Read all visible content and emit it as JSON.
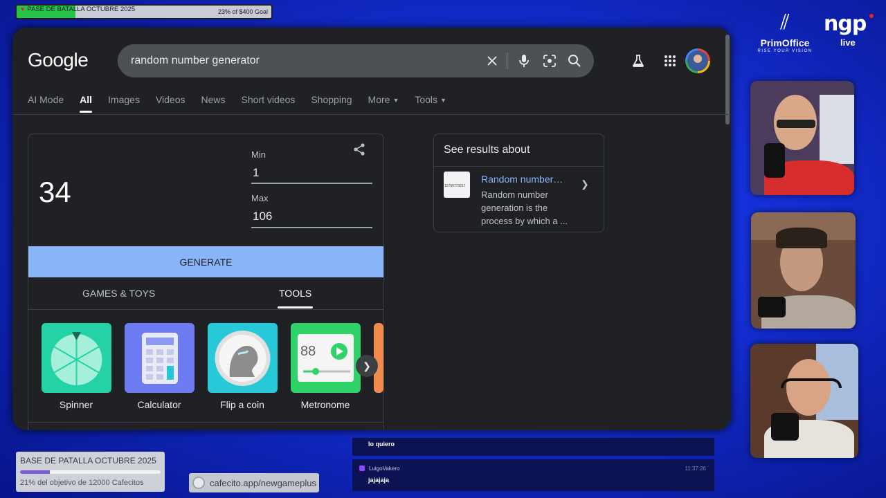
{
  "overlay": {
    "top_goal": {
      "title": "PASE DE BATALLA OCTUBRE 2025",
      "amount": "23% of $400 Goal",
      "progress_pct": 23
    },
    "bottom_goal": {
      "title": "BASE DE PATALLA OCTUBRE 2025",
      "subtitle": "21% del objetivo de 12000 Cafecitos",
      "progress_pct": 21
    },
    "cafecito_link": "cafecito.app/newgameplus",
    "brand_left": {
      "mark": "⫽",
      "name": "PrimOffice",
      "tagline": "RISE YOUR VISION"
    },
    "brand_right": {
      "big": "ngp",
      "small": "live"
    },
    "chat": [
      {
        "user": "",
        "text": "lo quiero",
        "time": ""
      },
      {
        "user": "LuigoVakero",
        "text": "jajajaja",
        "time": "11:37:26"
      }
    ]
  },
  "google": {
    "logo": "Google",
    "search_query": "random number generator",
    "icons": {
      "clear": "close-icon",
      "voice": "mic-icon",
      "lens": "lens-icon",
      "search": "search-icon",
      "labs": "flask-icon",
      "apps": "apps-grid-icon"
    },
    "tabs": [
      {
        "label": "AI Mode",
        "active": false
      },
      {
        "label": "All",
        "active": true
      },
      {
        "label": "Images",
        "active": false
      },
      {
        "label": "Videos",
        "active": false
      },
      {
        "label": "News",
        "active": false
      },
      {
        "label": "Short videos",
        "active": false
      },
      {
        "label": "Shopping",
        "active": false
      },
      {
        "label": "More",
        "active": false,
        "dropdown": true
      },
      {
        "label": "Tools",
        "active": false,
        "dropdown": true
      }
    ],
    "rng": {
      "result": "34",
      "min_label": "Min",
      "min_value": "1",
      "max_label": "Max",
      "max_value": "106",
      "generate_label": "GENERATE",
      "subtabs": [
        "GAMES & TOYS",
        "TOOLS"
      ],
      "active_subtab": "TOOLS",
      "tools": [
        {
          "label": "Spinner",
          "color": "#23d3a5"
        },
        {
          "label": "Calculator",
          "color": "#6d7cf2"
        },
        {
          "label": "Flip a coin",
          "color": "#27c9d8"
        },
        {
          "label": "Metronome",
          "color": "#2fd36a",
          "display": "88"
        }
      ]
    },
    "see_results": {
      "heading": "See results about",
      "link": "Random number…",
      "description": "Random number generation is the process by which a ...",
      "thumb_text": "12760773217"
    }
  }
}
